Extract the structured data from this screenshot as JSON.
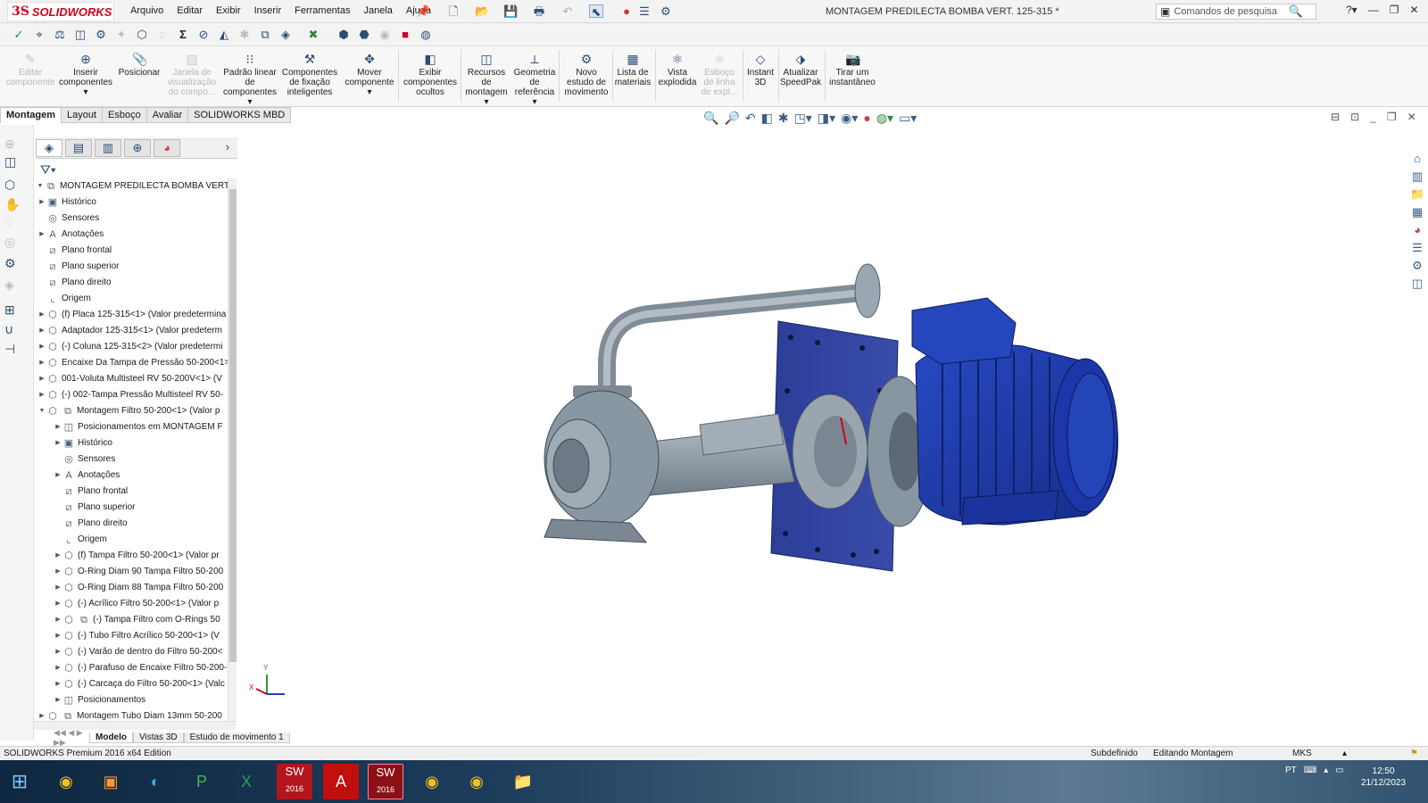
{
  "app": {
    "brand": "SOLIDWORKS",
    "brand_color": "#d0021b"
  },
  "menu": [
    "Arquivo",
    "Editar",
    "Exibir",
    "Inserir",
    "Ferramentas",
    "Janela",
    "Ajuda"
  ],
  "document_title": "MONTAGEM PREDILECTA BOMBA VERT. 125-315 *",
  "search": {
    "placeholder": "Comandos de pesquisa"
  },
  "ribbon": {
    "edit_component": "Editar componente",
    "insert_components": "Inserir componentes",
    "mate": "Posicionar",
    "component_preview": "Janela de visualização do compo...",
    "linear_pattern": "Padrão linear de componentes",
    "smart_fasteners": "Componentes de fixação inteligentes",
    "move_component": "Mover componente",
    "show_hidden": "Exibir componentes ocultos",
    "assembly_features": "Recursos de montagem",
    "reference_geometry": "Geometria de referência",
    "new_motion_study": "Novo estudo de movimento",
    "bill_of_materials": "Lista de materiais",
    "exploded_view": "Vista explodida",
    "explode_line_sketch": "Esboço de linha de expl...",
    "instant3d": "Instant 3D",
    "update_speedpak": "Atualizar SpeedPak",
    "take_snapshot": "Tirar um instantâneo"
  },
  "command_tabs": [
    "Montagem",
    "Layout",
    "Esboço",
    "Avaliar",
    "SOLIDWORKS MBD"
  ],
  "tree": {
    "root": "MONTAGEM PREDILECTA BOMBA VERT.",
    "items": [
      "Histórico",
      "Sensores",
      "Anotações",
      "Plano frontal",
      "Plano superior",
      "Plano direito",
      "Origem",
      "(f) Placa 125-315<1> (Valor predetermina",
      "Adaptador 125-315<1> (Valor predeterm",
      "(-) Coluna 125-315<2> (Valor predetermi",
      "Encaixe Da Tampa de Pressão 50-200<1>",
      "001-Voluta Multisteel  RV 50-200V<1> (V",
      "(-) 002-Tampa Pressão Multisteel  RV 50-",
      "Montagem Filtro 50-200<1> (Valor p",
      "Posicionamentos em MONTAGEM F",
      "Histórico",
      "Sensores",
      "Anotações",
      "Plano frontal",
      "Plano superior",
      "Plano direito",
      "Origem",
      "(f) Tampa Filtro 50-200<1> (Valor pr",
      "O-Ring Diam 90 Tampa Filtro 50-200",
      "O-Ring Diam 88 Tampa Filtro 50-200",
      "(-) Acrílico Filtro 50-200<1> (Valor p",
      "(-) Tampa Filtro com O-Rings 50",
      "(-) Tubo Filtro Acrílico 50-200<1> (V",
      "(-) Varão de dentro do Filtro 50-200<",
      "(-) Parafuso de Encaixe Filtro 50-200-",
      "(-) Carcaça do Filtro 50-200<1> (Valc",
      "Posicionamentos",
      "Montagem Tubo Diam 13mm 50-200"
    ]
  },
  "bottom_tabs": [
    "Modelo",
    "Vistas 3D",
    "Estudo de movimento 1"
  ],
  "status": {
    "edition": "SOLIDWORKS Premium 2016 x64 Edition",
    "state": "Subdefinido",
    "mode": "Editando Montagem",
    "units": "MKS"
  },
  "triad": {
    "x": "X",
    "y": "Y"
  },
  "taskbar": {
    "lang": "PT",
    "time": "12:50",
    "date": "21/12/2023",
    "sw_badge": "2016"
  },
  "colors": {
    "motor_blue": "#1f3fa8",
    "plate_blue": "#2f3f9a",
    "pump_grey": "#8c9aa6"
  }
}
